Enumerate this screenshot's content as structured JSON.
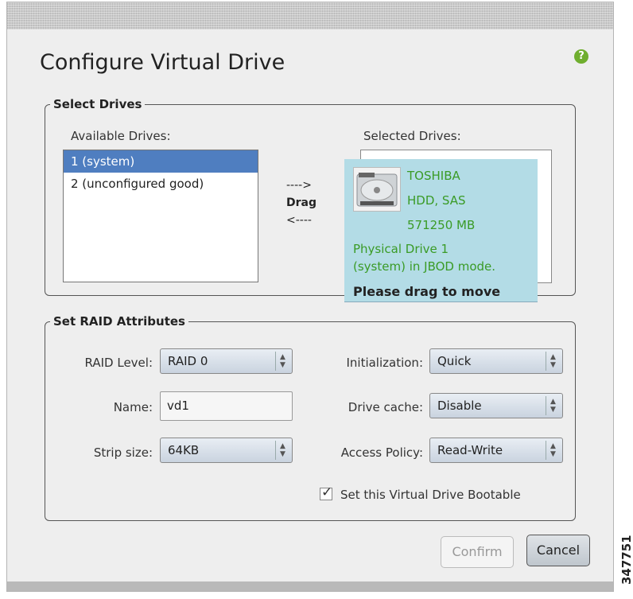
{
  "dialog": {
    "title": "Configure Virtual Drive",
    "help_icon_glyph": "?"
  },
  "select_drives": {
    "legend": "Select Drives",
    "available_label": "Available Drives:",
    "available_items": [
      "1 (system)",
      "2 (unconfigured good)"
    ],
    "selected_index": 0,
    "selected_label": "Selected Drives:",
    "drag_arrow_right": "---->",
    "drag_word": "Drag",
    "drag_arrow_left": "<----",
    "drag_card": {
      "vendor": "TOSHIBA",
      "type": "HDD, SAS",
      "size": "571250 MB",
      "note_line1": "Physical Drive 1",
      "note_line2": "(system) in JBOD mode.",
      "instruction": "Please drag to move",
      "icon": "hard-drive-icon"
    }
  },
  "raid_attributes": {
    "legend": "Set RAID Attributes",
    "raid_level": {
      "label": "RAID Level:",
      "value": "RAID 0"
    },
    "name": {
      "label": "Name:",
      "value": "vd1"
    },
    "strip_size": {
      "label": "Strip size:",
      "value": "64KB"
    },
    "initialization": {
      "label": "Initialization:",
      "value": "Quick"
    },
    "drive_cache": {
      "label": "Drive cache:",
      "value": "Disable"
    },
    "access_policy": {
      "label": "Access Policy:",
      "value": "Read-Write"
    },
    "bootable": {
      "label": "Set this Virtual Drive Bootable",
      "checked": true
    }
  },
  "buttons": {
    "confirm": "Confirm",
    "cancel": "Cancel"
  },
  "figure_id": "347751",
  "colors": {
    "selection": "#4f7ec0",
    "drag_card": "#b3dce6",
    "drive_text": "#3a9b26",
    "help_icon": "#6fae2e"
  }
}
